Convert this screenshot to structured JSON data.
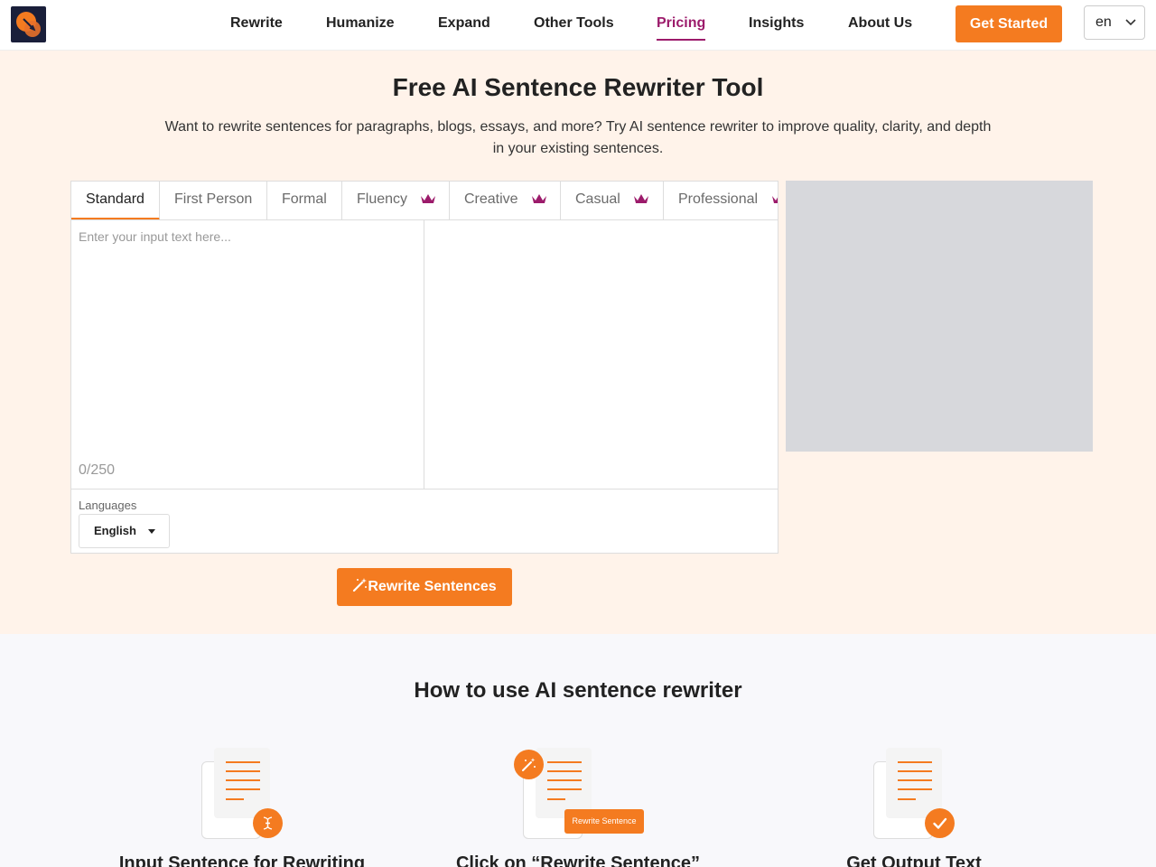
{
  "header": {
    "nav": [
      {
        "label": "Rewrite"
      },
      {
        "label": "Humanize"
      },
      {
        "label": "Expand"
      },
      {
        "label": "Other Tools"
      },
      {
        "label": "Pricing",
        "active": true
      },
      {
        "label": "Insights"
      },
      {
        "label": "About Us"
      }
    ],
    "cta_label": "Get Started",
    "language": "en"
  },
  "hero": {
    "title": "Free AI Sentence Rewriter Tool",
    "subtitle": "Want to rewrite sentences for paragraphs, blogs, essays, and more? Try AI sentence rewriter to improve quality, clarity, and depth in your existing sentences."
  },
  "tool": {
    "tabs": [
      {
        "label": "Standard",
        "active": true,
        "premium": false
      },
      {
        "label": "First Person",
        "premium": false
      },
      {
        "label": "Formal",
        "premium": false
      },
      {
        "label": "Fluency",
        "premium": true
      },
      {
        "label": "Creative",
        "premium": true
      },
      {
        "label": "Casual",
        "premium": true
      },
      {
        "label": "Professional",
        "premium": true
      }
    ],
    "input_placeholder": "Enter your input text here...",
    "input_value": "",
    "counter": "0/250",
    "languages_label": "Languages",
    "language_selected": "English",
    "rewrite_button": "Rewrite Sentences"
  },
  "howto": {
    "title": "How to use AI sentence rewriter",
    "steps": [
      {
        "title": "Input Sentence for Rewriting",
        "icon": "text-cursor-icon"
      },
      {
        "title": "Click on “Rewrite Sentence”",
        "icon": "magic-wand-icon",
        "button_label": "Rewrite Sentence"
      },
      {
        "title": "Get Output Text",
        "icon": "check-icon"
      }
    ]
  },
  "colors": {
    "accent": "#f47b20",
    "active_nav": "#9c1b6b",
    "hero_bg": "#fff3ea",
    "ad_placeholder": "#d7d8dc"
  }
}
